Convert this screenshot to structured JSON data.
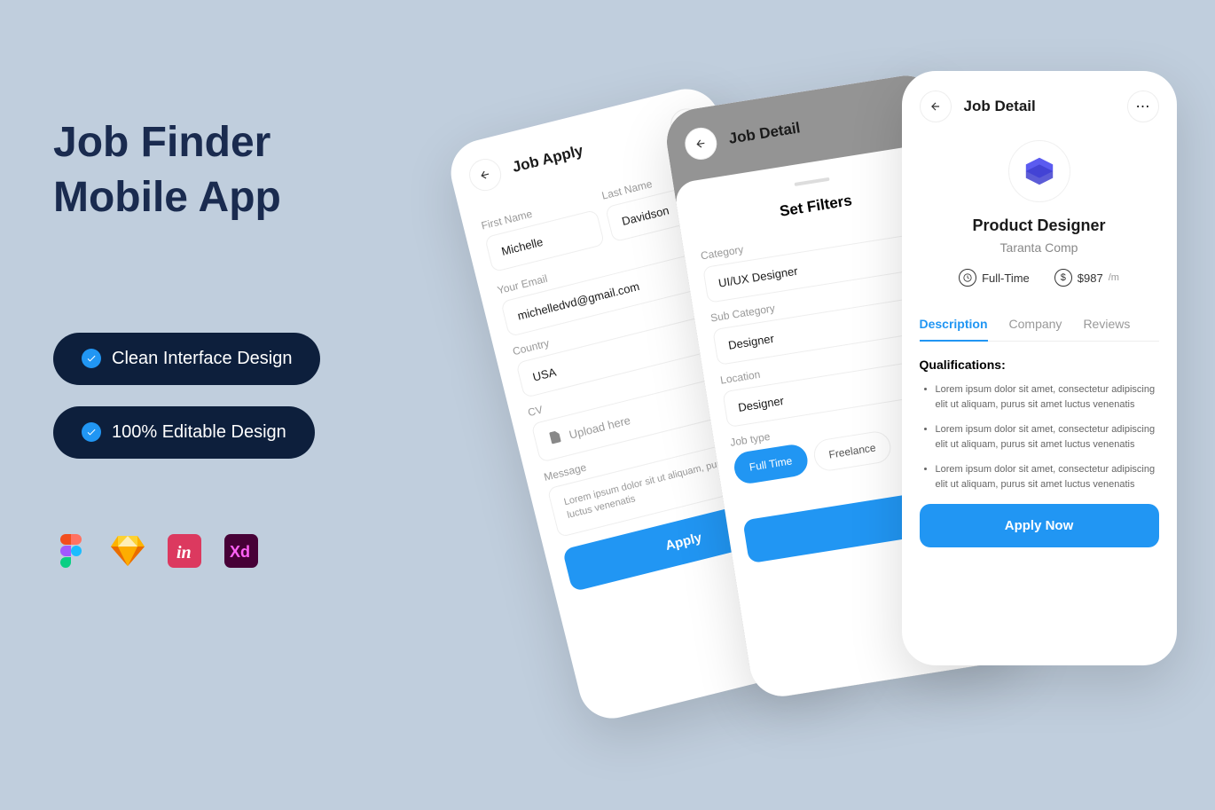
{
  "hero": {
    "line1": "Job Finder",
    "line2": "Mobile App"
  },
  "features": {
    "item1": "Clean Interface Design",
    "item2": "100% Editable Design"
  },
  "tools": [
    "figma",
    "sketch",
    "invision",
    "xd"
  ],
  "phone1": {
    "title": "Job Apply",
    "first_name_label": "First Name",
    "first_name_value": "Michelle",
    "last_name_label": "Last Name",
    "last_name_value": "Davidson",
    "email_label": "Your Email",
    "email_value": "michelledvd@gmail.com",
    "country_label": "Country",
    "country_value": "USA",
    "cv_label": "CV",
    "cv_value": "Upload here",
    "message_label": "Message",
    "message_value": "Lorem ipsum dolor sit ut aliquam, purus sit amet luctus venenatis",
    "apply_button": "Apply"
  },
  "phone2": {
    "title": "Job Detail",
    "sheet_title": "Set Filters",
    "category_label": "Category",
    "category_value": "UI/UX Designer",
    "subcategory_label": "Sub Category",
    "subcategory_value": "Designer",
    "location_label": "Location",
    "location_value": "Designer",
    "jobtype_label": "Job type",
    "jobtype_options": [
      "Full Time",
      "Freelance"
    ],
    "jobtype_selected": "Full Time"
  },
  "phone3": {
    "title": "Job Detail",
    "job_title": "Product Designer",
    "company": "Taranta Comp",
    "employment_type": "Full-Time",
    "salary_value": "$987",
    "salary_period": "/m",
    "tabs": {
      "description": "Description",
      "company_tab": "Company",
      "reviews": "Reviews"
    },
    "qualifications_title": "Qualifications:",
    "qualifications": [
      "Lorem ipsum dolor sit amet, consectetur adipiscing elit ut aliquam, purus sit amet luctus venenatis",
      "Lorem ipsum dolor sit amet, consectetur adipiscing elit ut aliquam, purus sit amet luctus venenatis",
      "Lorem ipsum dolor sit amet, consectetur adipiscing elit ut aliquam, purus sit amet luctus venenatis"
    ],
    "apply_button": "Apply Now"
  },
  "colors": {
    "primary": "#2196f3",
    "dark": "#0d1f3c"
  }
}
